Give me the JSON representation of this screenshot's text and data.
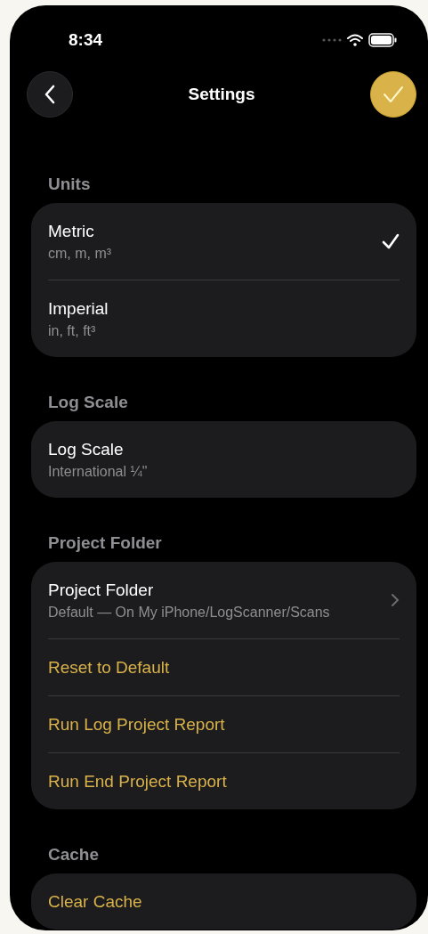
{
  "status_bar": {
    "time": "8:34"
  },
  "nav": {
    "title": "Settings"
  },
  "sections": [
    {
      "header": "Units",
      "rows": [
        {
          "kind": "option",
          "title": "Metric",
          "subtitle": "cm, m, m³",
          "selected": true
        },
        {
          "kind": "option",
          "title": "Imperial",
          "subtitle": "in, ft, ft³",
          "selected": false
        }
      ]
    },
    {
      "header": "Log Scale",
      "rows": [
        {
          "kind": "value",
          "title": "Log Scale",
          "subtitle": "International ¼\""
        }
      ]
    },
    {
      "header": "Project Folder",
      "rows": [
        {
          "kind": "link",
          "title": "Project Folder",
          "subtitle": "Default — On My iPhone/LogScanner/Scans"
        },
        {
          "kind": "action",
          "title": "Reset to Default"
        },
        {
          "kind": "action",
          "title": "Run Log Project Report"
        },
        {
          "kind": "action",
          "title": "Run End Project Report"
        }
      ]
    },
    {
      "header": "Cache",
      "rows": [
        {
          "kind": "action",
          "title": "Clear Cache"
        }
      ]
    }
  ]
}
